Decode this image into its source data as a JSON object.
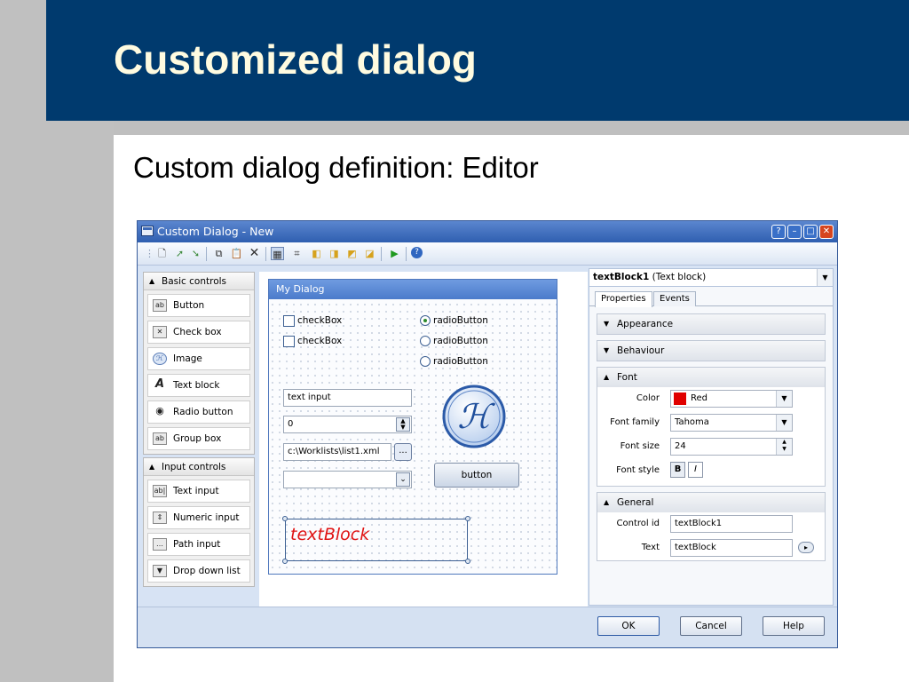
{
  "slide": {
    "title": "Customized dialog",
    "subtitle": "Custom dialog definition: Editor"
  },
  "window": {
    "title": "Custom Dialog - New"
  },
  "left_panel": {
    "basic_header": "Basic controls",
    "basic_items": [
      "Button",
      "Check box",
      "Image",
      "Text block",
      "Radio button",
      "Group box"
    ],
    "input_header": "Input controls",
    "input_items": [
      "Text input",
      "Numeric input",
      "Path input",
      "Drop down list"
    ]
  },
  "canvas": {
    "dialog_title": "My Dialog",
    "checkbox1": "checkBox",
    "checkbox2": "checkBox",
    "radio1": "radioButton",
    "radio2": "radioButton",
    "radio3": "radioButton",
    "text_input": "text input",
    "numeric_input": "0",
    "path_input": "c:\\Worklists\\list1.xml",
    "path_button": "...",
    "dropdown_value": "",
    "button_label": "button",
    "text_block": "textBlock",
    "image_glyph": "ℋ"
  },
  "properties": {
    "selected_name": "textBlock1",
    "selected_type": "(Text block)",
    "tabs": [
      "Properties",
      "Events"
    ],
    "sections": {
      "appearance": "Appearance",
      "behaviour": "Behaviour",
      "font": "Font",
      "general": "General"
    },
    "font": {
      "color_label": "Color",
      "color_value": "Red",
      "color_swatch": "#e00000",
      "family_label": "Font family",
      "family_value": "Tahoma",
      "size_label": "Font size",
      "size_value": "24",
      "style_label": "Font style",
      "bold": "B",
      "italic": "I"
    },
    "general": {
      "control_id_label": "Control id",
      "control_id_value": "textBlock1",
      "text_label": "Text",
      "text_value": "textBlock"
    }
  },
  "buttons": {
    "ok": "OK",
    "cancel": "Cancel",
    "help": "Help"
  }
}
